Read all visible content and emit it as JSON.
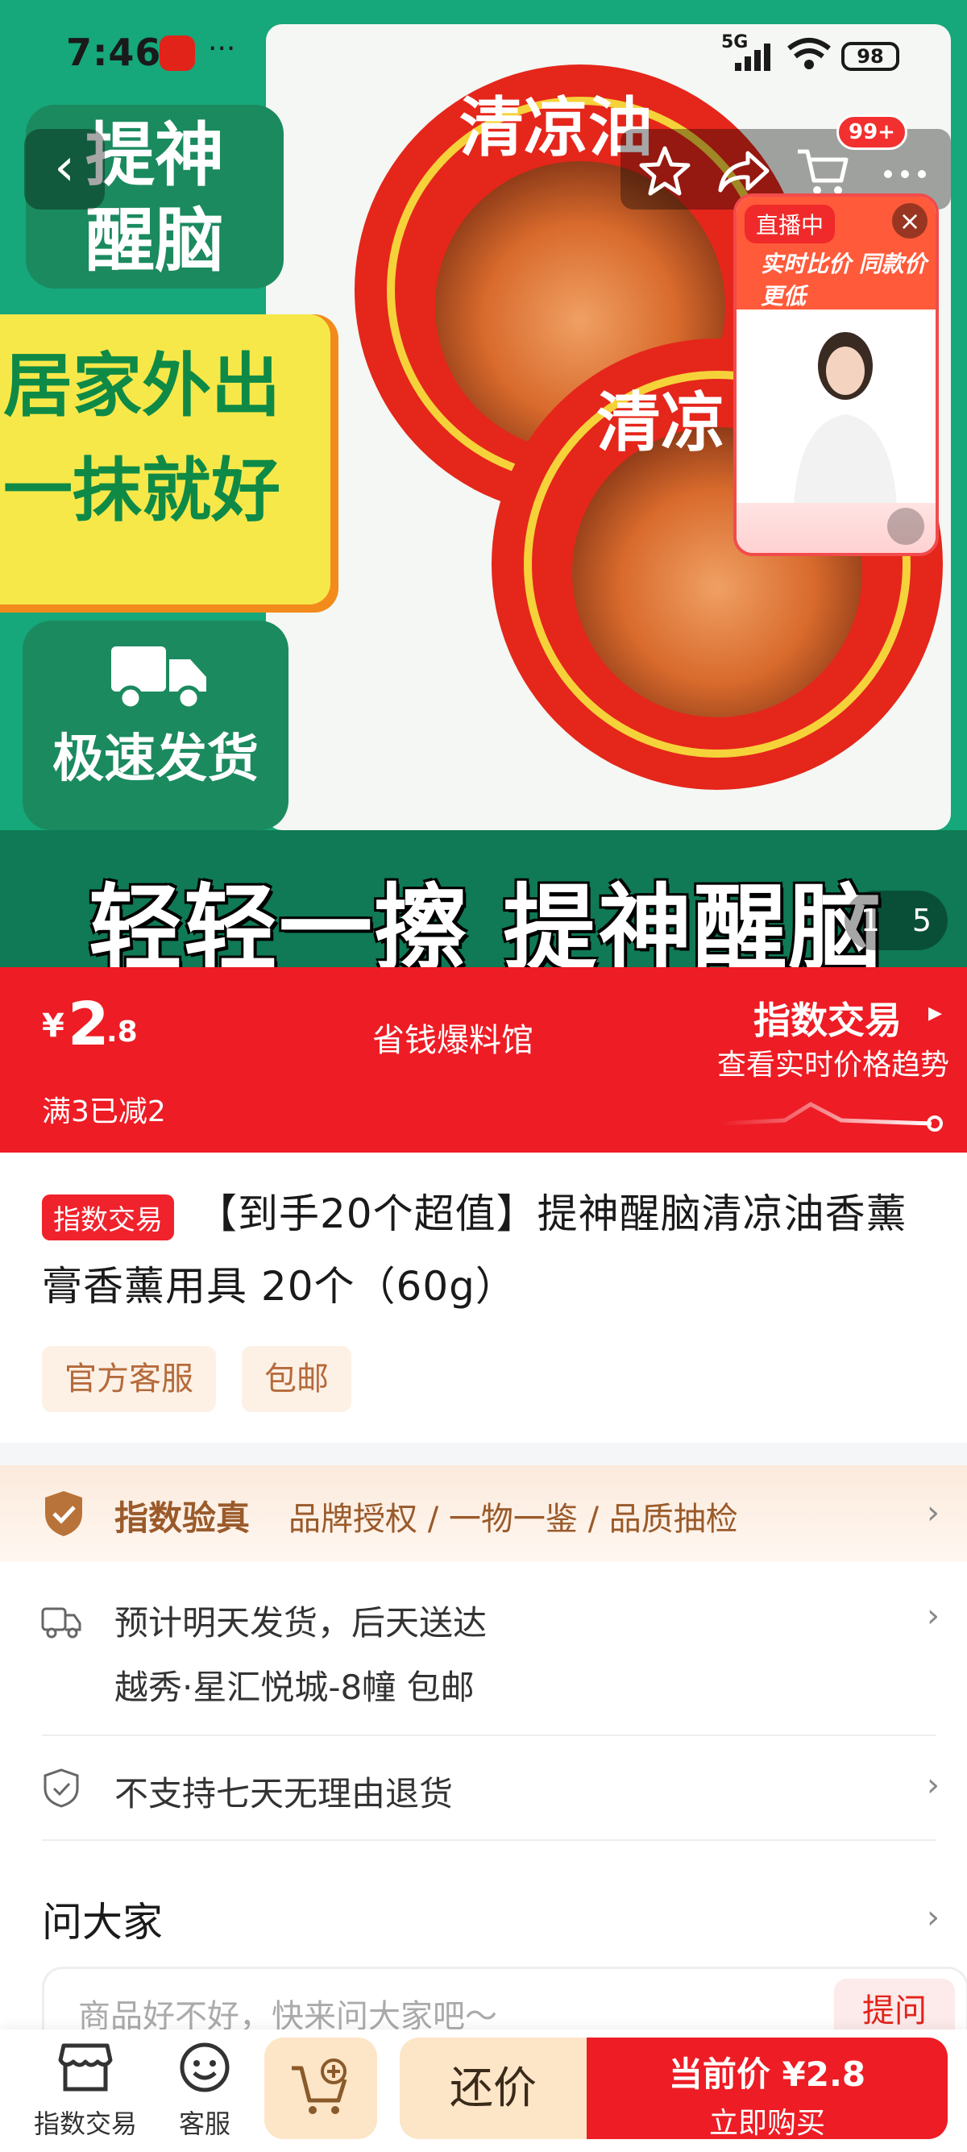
{
  "status_bar": {
    "time": "7:46",
    "dots": "···",
    "network": "5G",
    "battery": "98"
  },
  "hero": {
    "tag_top": "提神\n醒脑",
    "banner": "居家外出\n一抹就好",
    "tag_ship": "极速发货",
    "tin_label_top": "清凉油",
    "tin_label_small": "清凉",
    "bottom_slogan": "轻轻一擦 提神醒脑",
    "counter_current": "1",
    "counter_total": "5",
    "cart_badge": "99+"
  },
  "live": {
    "label": "直播中",
    "slogan": "实时比价 同款价更低"
  },
  "price": {
    "symbol": "¥",
    "integer": "2",
    "decimal": ".8",
    "shop": "省钱爆料馆",
    "promo": "满3已减2",
    "index_title": "指数交易",
    "index_sub": "查看实时价格趋势"
  },
  "product": {
    "badge": "指数交易",
    "title_line1": "【到手20个超值】提神醒脑清凉油香薰",
    "title_line2": "膏香薰用具 20个（60g）",
    "chips": [
      "官方客服",
      "包邮"
    ]
  },
  "verify": {
    "title": "指数验真",
    "text": "品牌授权 / 一物一鉴 / 品质抽检"
  },
  "shipping": {
    "line1": "预计明天发货，后天送达",
    "line2": "越秀·星汇悦城-8幢  包邮"
  },
  "returns": {
    "text": "不支持七天无理由退货"
  },
  "ask": {
    "title": "问大家",
    "placeholder": "商品好不好，快来问大家吧～",
    "button": "提问"
  },
  "bottom_bar": {
    "index_label": "指数交易",
    "service_label": "客服",
    "bargain": "还价",
    "buy_line1": "当前价 ¥2.8",
    "buy_line2": "立即购买"
  },
  "colors": {
    "brand_red": "#ee1c25",
    "hero_green": "#16a77a",
    "accent_brown": "#9a5a2a"
  }
}
